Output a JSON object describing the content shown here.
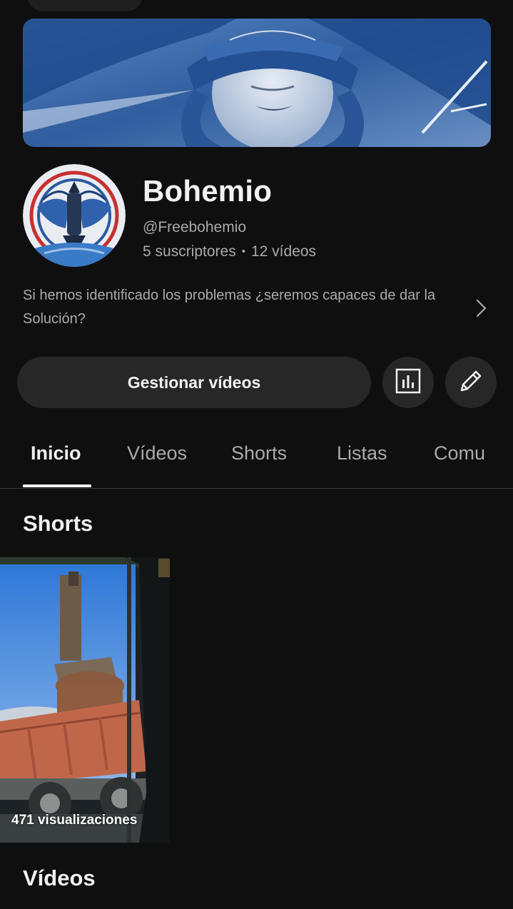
{
  "channel": {
    "name": "Bohemio",
    "handle": "@Freebohemio",
    "subscribers": "5 suscriptores",
    "videos_count": "12 vídeos",
    "stats_separator": "•",
    "description": "Si hemos identificado los problemas ¿seremos capaces de dar la Solución?"
  },
  "actions": {
    "manage_label": "Gestionar vídeos",
    "analytics_icon": "analytics-icon",
    "edit_icon": "pencil-icon"
  },
  "tabs": [
    {
      "label": "Inicio",
      "active": true
    },
    {
      "label": "Vídeos",
      "active": false
    },
    {
      "label": "Shorts",
      "active": false
    },
    {
      "label": "Listas",
      "active": false
    },
    {
      "label": "Comu",
      "active": false
    }
  ],
  "sections": {
    "shorts_title": "Shorts",
    "videos_title": "Vídeos"
  },
  "shorts": [
    {
      "views": "471 visualizaciones"
    }
  ],
  "colors": {
    "background": "#0f0f0f",
    "button_bg": "#272727",
    "text_primary": "#f1f1f1",
    "text_secondary": "#aaaaaa"
  }
}
